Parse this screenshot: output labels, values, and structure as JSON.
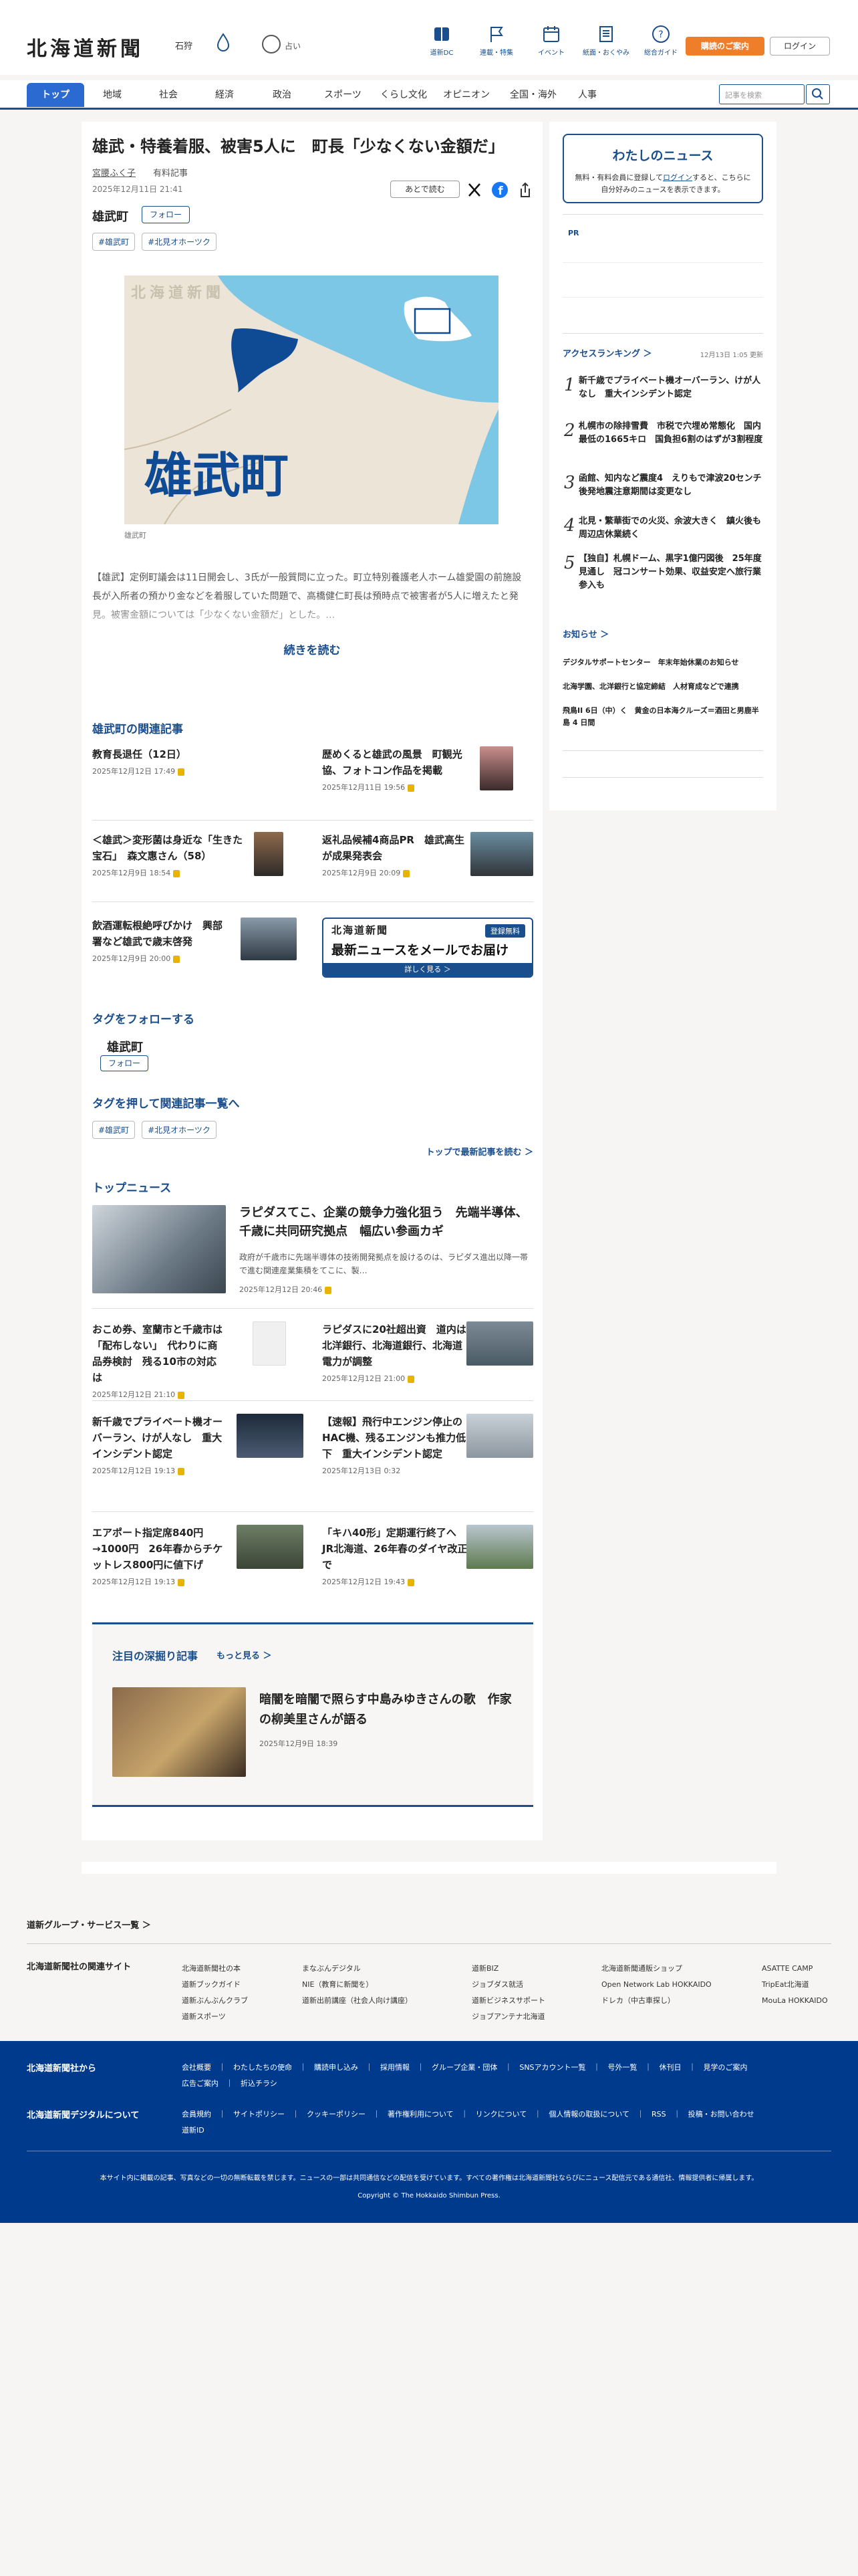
{
  "header": {
    "logo": "北海道新聞",
    "location": "石狩",
    "weather_text": "占い",
    "nav_icons": [
      {
        "label": "道新DC",
        "icon": "book-icon"
      },
      {
        "label": "連載・特集",
        "icon": "flag-icon"
      },
      {
        "label": "イベント",
        "icon": "calendar-icon"
      },
      {
        "label": "紙面・おくやみ",
        "icon": "newspaper-icon"
      },
      {
        "label": "総合ガイド",
        "icon": "help-icon"
      }
    ],
    "plan_button": "購読のご案内",
    "login_button": "ログイン"
  },
  "nav": {
    "items": [
      "トップ",
      "地域",
      "社会",
      "経済",
      "政治",
      "スポーツ",
      "くらし文化",
      "オピニオン",
      "全国・海外",
      "人事"
    ],
    "search_placeholder": "記事を検索"
  },
  "article": {
    "headline": "雄武・特養着服、被害5人に　町長「少なくない金額だ」",
    "author": "宮腰ふく子",
    "badge": "有料記事",
    "date": "2025年12月11日 21:41",
    "save_label": "あとで読む",
    "place": "雄武町",
    "follow_label": "フォロー",
    "tags": [
      "#雄武町",
      "#北見オホーツク"
    ],
    "map_logo": "北海道新聞",
    "map_label": "雄武町",
    "map_caption": "雄武町",
    "lead": "【雄武】定例町議会は11日開会し、3氏が一般質問に立った。町立特別養護老人ホーム雄愛園の前施設長が入所者の預かり金などを着服していた問題で、高橋健仁町長は預時点で被害者が5人に増えたと発見。被害金額については「少なくない金額だ」とした。…",
    "read_more": "続きを読む"
  },
  "related": {
    "title": "雄武町の関連記事",
    "items": [
      {
        "title": "教育長退任（12日）",
        "date": "2025年12月12日 17:49"
      },
      {
        "title": "歴めくると雄武の風景　町観光協、フォトコン作品を掲載",
        "date": "2025年12月11日 19:56"
      },
      {
        "title": "＜雄武＞変形菌は身近な「生きた宝石」　森文惠さん（58）",
        "date": "2025年12月9日 18:54"
      },
      {
        "title": "返礼品候補4商品PR　雄武高生が成果発表会",
        "date": "2025年12月9日 20:09"
      },
      {
        "title": "飲酒運転根絶呼びかけ　興部署など雄武で歳末啓発",
        "date": "2025年12月9日 20:00"
      }
    ],
    "mail_banner_logo": "北海道新聞",
    "mail_banner_badge": "登録無料",
    "mail_banner_title": "最新ニュースをメールでお届け",
    "mail_banner_link": "詳しく見る ＞"
  },
  "follow_section": {
    "title": "タグをフォローする",
    "place": "雄武町",
    "follow_label": "フォロー",
    "tags_title": "タグを押して関連記事一覧へ",
    "tags": [
      "#雄武町",
      "#北見オホーツク"
    ],
    "back_link": "トップで最新記事を読む"
  },
  "top_news": {
    "title": "トップニュース",
    "lead_title": "ラピダスてこ、企業の競争力強化狙う　先端半導体、千歳に共同研究拠点　幅広い参画カギ",
    "lead_summary": "政府が千歳市に先端半導体の技術開発拠点を設けるのは、ラピダス進出以降一帯で進む関連産業集積をてこに、製…",
    "lead_date": "2025年12月12日 20:46",
    "items": [
      {
        "title": "おこめ券、室蘭市と千歳市は「配布しない」　代わりに商品券検討　残る10市の対応は",
        "date": "2025年12月12日 21:10"
      },
      {
        "title": "ラピダスに20社超出資　道内は北洋銀行、北海道銀行、北海道電力が調整",
        "date": "2025年12月12日 21:00"
      },
      {
        "title": "新千歳でプライベート機オーバーラン、けが人なし　重大インシデント認定",
        "date": "2025年12月12日 19:13"
      },
      {
        "title": "【速報】飛行中エンジン停止のHAC機、残るエンジンも推力低下　重大インシデント認定",
        "date": "2025年12月13日 0:32"
      },
      {
        "title": "エアポート指定席840円→1000円　26年春からチケットレス800円に値下げ",
        "date": "2025年12月12日 19:13"
      },
      {
        "title": "「キハ40形」定期運行終了へ　JR北海道、26年春のダイヤ改正で",
        "date": "2025年12月12日 19:43"
      }
    ]
  },
  "deep": {
    "title": "注目の深掘り記事",
    "more": "もっと見る",
    "item_title": "暗闇を暗闇で照らす中島みゆきさんの歌　作家の柳美里さんが語る",
    "item_date": "2025年12月9日 18:39"
  },
  "sidebar": {
    "mynews_title": "わたしのニュース",
    "mynews_text_1": "無料・有料会員に登録して",
    "mynews_text_link": "ログイン",
    "mynews_text_2": "すると、こちらに自分好みのニュースを表示できます。",
    "pr": "PR",
    "ranking_title": "アクセスランキング",
    "ranking_updated": "12月13日 1:05 更新",
    "ranking": [
      {
        "no": "1",
        "title": "新千歳でプライベート機オーバーラン、けが人なし　重大インシデント認定"
      },
      {
        "no": "2",
        "title": "札幌市の除排雪費　市税で穴埋め常態化　国内最低の1665キロ　国負担6割のはずが3割程度"
      },
      {
        "no": "3",
        "title": "函館、知内など震度4　えりもで津波20センチ　後発地震注意期間は変更なし"
      },
      {
        "no": "4",
        "title": "北見・繁華街での火災、余波大きく　鎮火後も周辺店休業続く"
      },
      {
        "no": "5",
        "title": "【独自】札幌ドーム、黒字1億円図後　25年度見通し　冠コンサート効果、収益安定へ旅行業参入も"
      }
    ],
    "notice_title": "お知らせ",
    "notices": [
      "デジタルサポートセンター　年末年始休業のお知らせ",
      "北海学園、北洋銀行と協定締結　人材育成などで連携",
      "飛鳥II 6日（中）く　黄金の日本海クルーズ＝酒田と男鹿半島 4 日間"
    ]
  },
  "footer": {
    "group_title": "道新グループ・サービス一覧",
    "related_sites_title": "北海道新聞社の関連サイト",
    "related_sites": [
      [
        "北海道新聞社の本",
        "道新ブックガイド",
        "道新ぶんぶんクラブ",
        "道新スポーツ"
      ],
      [
        "まなぶんデジタル",
        "NIE（教育に新聞を）",
        "道新出前講座（社会人向け講座）"
      ],
      [
        "道新BIZ",
        "ジョブダス就活",
        "道新ビジネスサポート",
        "ジョブアンテナ北海道"
      ],
      [
        "北海道新聞通販ショップ",
        "Open Network Lab HOKKAIDO",
        "ドレカ（中古車探し）"
      ],
      [
        "ASATTE CAMP",
        "TripEat北海道",
        "MouLa HOKKAIDO"
      ]
    ],
    "company_title": "北海道新聞社から",
    "company_links": [
      "会社概要",
      "わたしたちの使命",
      "購読申し込み",
      "採用情報",
      "グループ企業・団体",
      "SNSアカウント一覧",
      "号外一覧",
      "休刊日",
      "見学のご案内",
      "広告ご案内",
      "折込チラシ"
    ],
    "digital_title": "北海道新聞デジタルについて",
    "digital_links": [
      "会員規約",
      "サイトポリシー",
      "クッキーポリシー",
      "著作権利用について",
      "リンクについて",
      "個人情報の取扱について",
      "RSS",
      "投稿・お問い合わせ",
      "道新ID"
    ],
    "notice": "本サイト内に掲載の記事、写真などの一切の無断転載を禁じます。ニュースの一部は共同通信などの配信を受けています。すべての著作権は北海道新聞社ならびにニュース配信元である通信社、情報提供者に帰属します。",
    "copyright": "Copyright © The Hokkaido Shimbun Press."
  },
  "colors": {
    "brand": "#1a4e8c",
    "accent": "#ef7e2a",
    "active_tab": "#2b6ad0",
    "footer_bg": "#003a8c"
  }
}
